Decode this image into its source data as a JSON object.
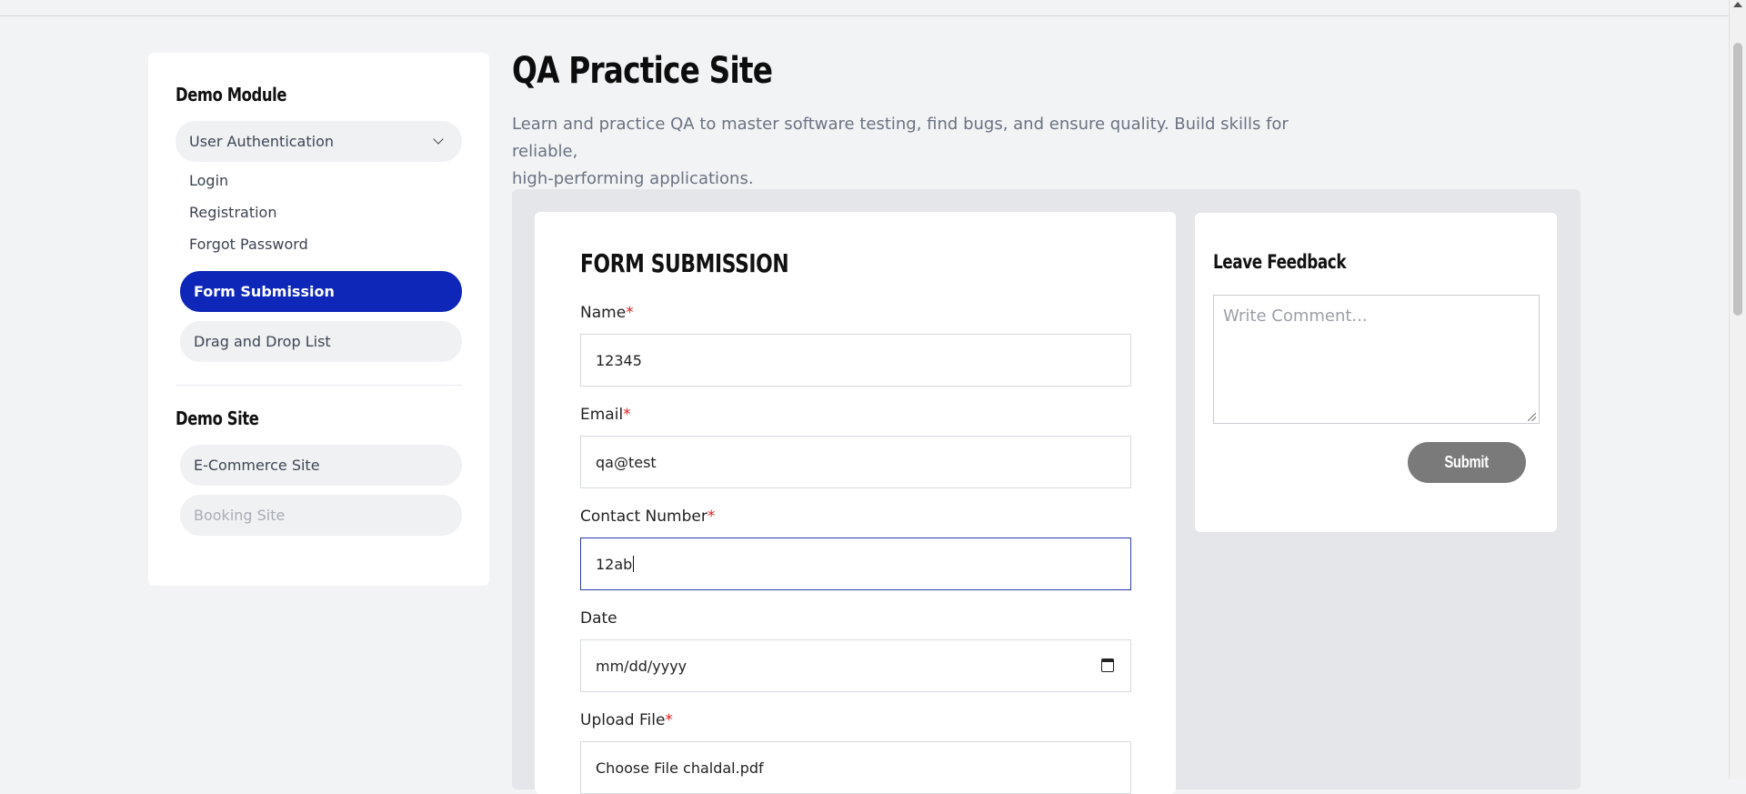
{
  "sidebar": {
    "demo_module_heading": "Demo Module",
    "user_auth_label": "User Authentication",
    "sub_items": [
      "Login",
      "Registration",
      "Forgot Password"
    ],
    "form_submission_label": "Form Submission",
    "drag_drop_label": "Drag and Drop List",
    "demo_site_heading": "Demo Site",
    "ecommerce_label": "E-Commerce Site",
    "booking_label": "Booking Site"
  },
  "header": {
    "title": "QA Practice Site",
    "description_line1": "Learn and practice QA to master software testing, find bugs, and ensure quality. Build skills for reliable,",
    "description_line2": "high-performing applications."
  },
  "form": {
    "title": "FORM SUBMISSION",
    "name_label": "Name",
    "name_value": "12345",
    "email_label": "Email",
    "email_value": "qa@test",
    "contact_label": "Contact Number",
    "contact_value": "12ab",
    "date_label": "Date",
    "date_value": "mm/dd/yyyy",
    "upload_label": "Upload File",
    "upload_value": "Choose File chaldal.pdf",
    "required_marker": "*"
  },
  "feedback": {
    "title": "Leave Feedback",
    "comment_placeholder": "Write Comment...",
    "submit_label": "Submit"
  },
  "icons": {
    "dropdown": "chevron-down-icon",
    "calendar": "calendar-icon"
  },
  "colors": {
    "accent": "#0f27b8",
    "page_bg": "#f2f3f5",
    "required": "#dd2222",
    "submit_bg": "#7a7a7a"
  }
}
